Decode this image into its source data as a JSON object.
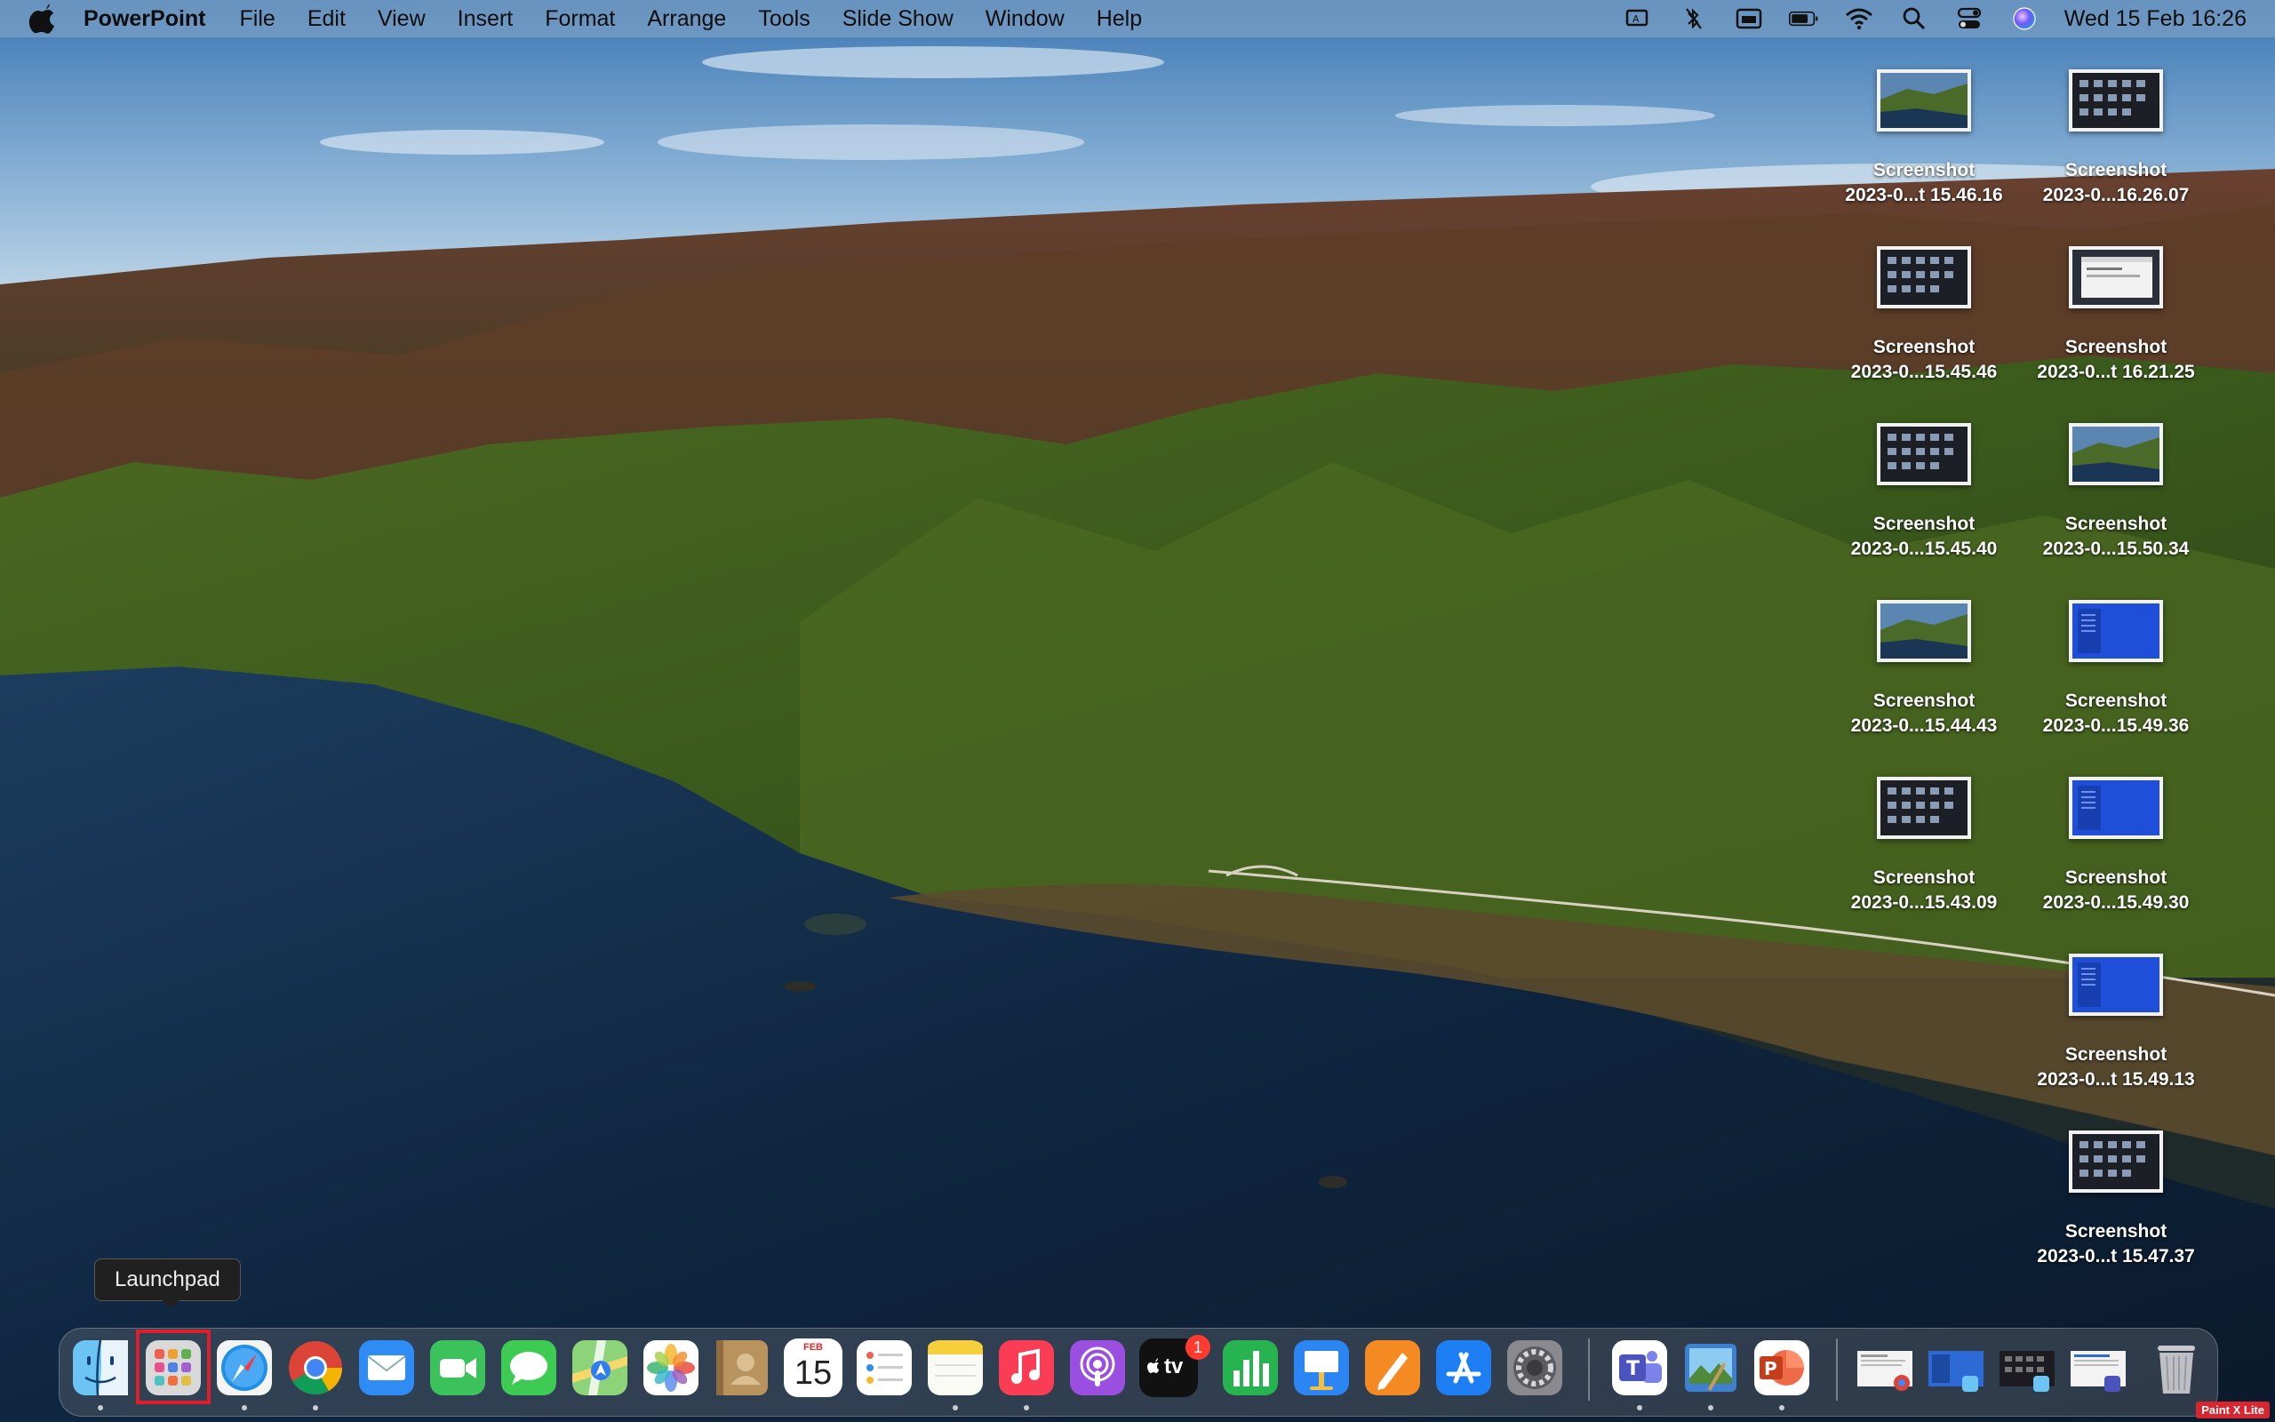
{
  "menubar": {
    "app_name": "PowerPoint",
    "menus": [
      "File",
      "Edit",
      "View",
      "Insert",
      "Format",
      "Arrange",
      "Tools",
      "Slide Show",
      "Window",
      "Help"
    ],
    "clock": "Wed 15 Feb  16:26",
    "status_icons": [
      "screen-mirroring-icon",
      "bluetooth-off-icon",
      "keyboard-input-icon",
      "battery-icon",
      "wifi-icon",
      "spotlight-search-icon",
      "control-center-icon",
      "siri-icon"
    ]
  },
  "desktop": {
    "items": [
      {
        "title": "Screenshot",
        "subtitle": "2023-0...t 15.46.16",
        "thumb": "landscape"
      },
      {
        "title": "Screenshot",
        "subtitle": "2023-0...16.26.07",
        "thumb": "grid"
      },
      {
        "title": "Screenshot",
        "subtitle": "2023-0...15.45.46",
        "thumb": "grid"
      },
      {
        "title": "Screenshot",
        "subtitle": "2023-0...t 16.21.25",
        "thumb": "window"
      },
      {
        "title": "Screenshot",
        "subtitle": "2023-0...15.45.40",
        "thumb": "grid"
      },
      {
        "title": "Screenshot",
        "subtitle": "2023-0...15.50.34",
        "thumb": "landscape"
      },
      {
        "title": "Screenshot",
        "subtitle": "2023-0...15.44.43",
        "thumb": "landscape"
      },
      {
        "title": "Screenshot",
        "subtitle": "2023-0...15.49.36",
        "thumb": "blue"
      },
      {
        "title": "Screenshot",
        "subtitle": "2023-0...15.43.09",
        "thumb": "grid"
      },
      {
        "title": "Screenshot",
        "subtitle": "2023-0...15.49.30",
        "thumb": "blue"
      },
      {
        "title": "Screenshot",
        "subtitle": "2023-0...t 15.49.13",
        "thumb": "blue"
      },
      {
        "title": "Screenshot",
        "subtitle": "2023-0...t 15.47.37",
        "thumb": "grid"
      }
    ]
  },
  "tooltip": {
    "text": "Launchpad"
  },
  "dock": {
    "apps": [
      "Finder",
      "Launchpad",
      "Safari",
      "Google Chrome",
      "Mail",
      "FaceTime",
      "Messages",
      "Maps",
      "Photos",
      "Contacts",
      "Calendar",
      "Reminders",
      "Notes",
      "Music",
      "Podcasts",
      "TV",
      "Numbers",
      "Keynote",
      "Pages",
      "App Store",
      "System Preferences",
      "Microsoft Teams",
      "Preview",
      "Microsoft PowerPoint"
    ],
    "calendar": {
      "month": "FEB",
      "day": "15"
    },
    "tv_badge": "1",
    "tv_label": "tv",
    "highlighted_app": "Launchpad",
    "minimized_windows": 4,
    "trash": "Trash"
  },
  "watermark": "Paint X Lite",
  "colors": {
    "highlight": "#e01e2a",
    "badge": "#ff3b30"
  }
}
